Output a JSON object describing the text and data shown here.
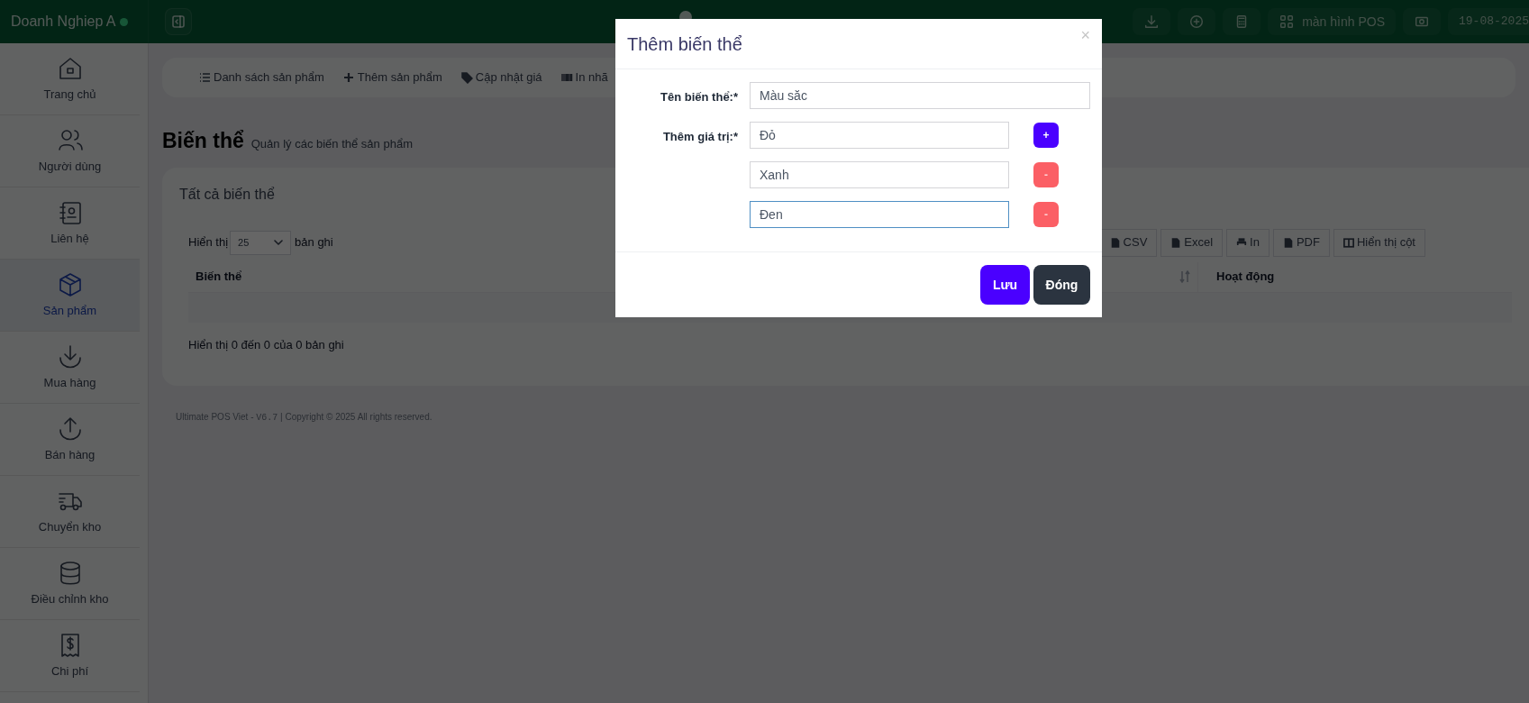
{
  "top_bar": {
    "brand": "Doanh Nghiep A",
    "pos_button": "màn hình POS",
    "date": "19-08-2025"
  },
  "sidebar": {
    "items": [
      {
        "label": "Trang chủ",
        "selected": false
      },
      {
        "label": "Người dùng",
        "selected": false
      },
      {
        "label": "Liên hệ",
        "selected": false
      },
      {
        "label": "Sản phẩm",
        "selected": true
      },
      {
        "label": "Mua hàng",
        "selected": false
      },
      {
        "label": "Bán hàng",
        "selected": false
      },
      {
        "label": "Chuyển kho",
        "selected": false
      },
      {
        "label": "Điều chỉnh kho",
        "selected": false
      },
      {
        "label": "Chi phí",
        "selected": false
      }
    ]
  },
  "sub_nav": [
    "Danh sách sản phẩm",
    "Thêm sản phẩm",
    "Cập nhật giá",
    "In nhã"
  ],
  "page_header": {
    "title": "Biến thể",
    "subtitle": "Quản lý các biến thể sản phẩm"
  },
  "card": {
    "title": "Tất cả biến thể",
    "length_prefix": "Hiển thị",
    "length_value": "25",
    "length_suffix": "bản ghi",
    "export_buttons": [
      "CSV",
      "Excel",
      "In",
      "PDF",
      "Hiển thị cột"
    ],
    "table": {
      "columns": [
        "Biến thể",
        "Hoạt động"
      ]
    },
    "info": "Hiển thị 0 đến 0 của 0 bản ghi"
  },
  "footer": {
    "prefix": "Ultimate POS Viet - ",
    "version": "V6.7",
    "suffix": " | Copyright © 2025 All rights reserved."
  },
  "modal": {
    "title": "Thêm biến thể",
    "close": "×",
    "name_label": "Tên biến thể:*",
    "name_value": "Màu săc",
    "values_label": "Thêm giá trị:*",
    "values": [
      {
        "value": "Đỏ",
        "kind": "add",
        "button": "+",
        "focused": false
      },
      {
        "value": "Xanh",
        "kind": "remove",
        "button": "-",
        "focused": false
      },
      {
        "value": "Đen",
        "kind": "remove",
        "button": "-",
        "focused": true
      }
    ],
    "buttons": [
      {
        "label": "Lưu",
        "kind": "primary"
      },
      {
        "label": "Đóng",
        "kind": "secondary"
      }
    ]
  }
}
